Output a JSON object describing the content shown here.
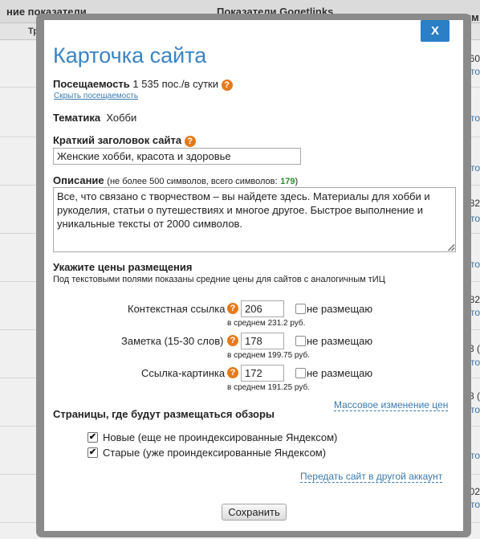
{
  "background": {
    "header_left": "ние показатели",
    "header_center": "Показатели Gogetlinks",
    "header_right": "Лим",
    "subheader_left": "Тра",
    "right_column": [
      {
        "num": "160",
        "link": "Авто"
      },
      {
        "num": "",
        "link": "Авто"
      },
      {
        "num": "",
        "link": "Авто"
      },
      {
        "num": "282",
        "link": "Авто"
      },
      {
        "num": "",
        "link": "Авто"
      },
      {
        "num": "282",
        "link": "Авто"
      },
      {
        "num": "13 (",
        "link": "Авто"
      },
      {
        "num": "18 (",
        "link": "Авто"
      },
      {
        "num": "",
        "link": "Авто"
      },
      {
        "num": "102",
        "link": "Авто"
      }
    ]
  },
  "modal": {
    "close_label": "X",
    "title": "Карточка сайта",
    "traffic": {
      "label": "Посещаемость",
      "value": "1 535 пос./в сутки",
      "hide_link": "Скрыть посещаемость"
    },
    "topic": {
      "label": "Тематика",
      "value": "Хобби"
    },
    "short_title": {
      "label": "Краткий заголовок сайта",
      "value": "Женские хобби, красота и здоровье"
    },
    "description": {
      "label": "Описание",
      "note_prefix": "(не более 500 символов, всего символов:",
      "count": "179",
      "note_suffix": ")",
      "value": "Все, что связано с творчеством – вы найдете здесь. Материалы для хобби и рукоделия, статьи о путешествиях и многое другое. Быстрое выполнение и уникальные тексты от 2000 символов."
    },
    "prices": {
      "heading": "Укажите цены размещения",
      "subheading": "Под текстовыми полями показаны средние цены для сайтов с аналогичным тИЦ",
      "rows": [
        {
          "label": "Контекстная ссылка",
          "value": "206",
          "no_place": "не размещаю",
          "avg": "в среднем 231.2 руб."
        },
        {
          "label": "Заметка (15-30 слов)",
          "value": "178",
          "no_place": "не размещаю",
          "avg": "в среднем 199.75 руб."
        },
        {
          "label": "Ссылка-картинка",
          "value": "172",
          "no_place": "не размещаю",
          "avg": "в среднем 191.25 руб."
        }
      ],
      "bulk_link": "Массовое изменение цен"
    },
    "pages": {
      "heading": "Страницы, где будут размещаться обзоры",
      "options": [
        {
          "label": "Новые (еще не проиндексированные Яндексом)",
          "checked": true
        },
        {
          "label": "Старые (уже проиндексированные Яндексом)",
          "checked": true
        }
      ]
    },
    "transfer_link": "Передать сайт в другой аккаунт",
    "save_label": "Сохранить",
    "help_glyph": "?",
    "check_glyph": "✔"
  },
  "colors": {
    "accent": "#2b7fc6",
    "title": "#3a84c4",
    "help": "#e57a1c",
    "link": "#3a7ab0",
    "count": "#2f8f2f"
  }
}
